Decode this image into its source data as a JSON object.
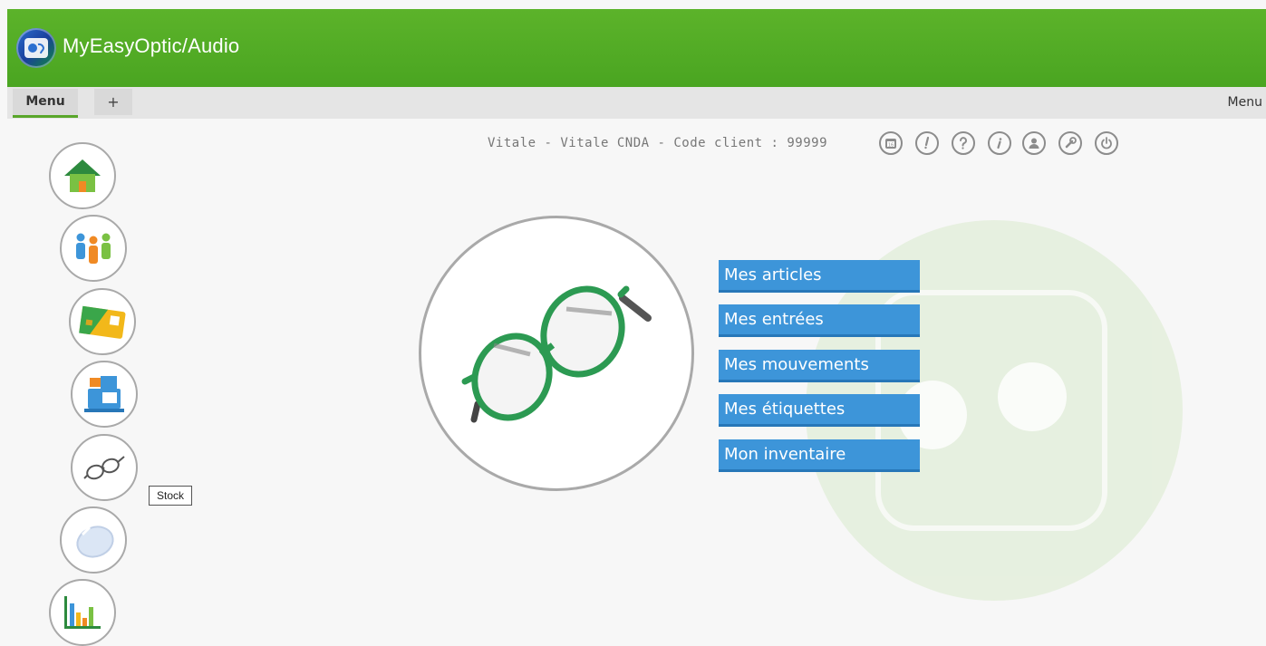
{
  "app": {
    "title": "MyEasyOptic/Audio"
  },
  "tabs": {
    "menu": "Menu",
    "add": "+",
    "right": "Menu"
  },
  "client_info": "Vitale - Vitale CNDA - Code client : 99999",
  "toolbar": [
    {
      "icon": "calendar-icon"
    },
    {
      "icon": "alert-icon"
    },
    {
      "icon": "help-icon"
    },
    {
      "icon": "info-icon"
    },
    {
      "icon": "user-icon"
    },
    {
      "icon": "settings-icon"
    },
    {
      "icon": "power-icon"
    }
  ],
  "sidebar": [
    {
      "icon": "home-icon"
    },
    {
      "icon": "clients-icon"
    },
    {
      "icon": "vitale-card-icon"
    },
    {
      "icon": "cash-register-icon"
    },
    {
      "icon": "glasses-icon",
      "tooltip": "Stock"
    },
    {
      "icon": "lens-icon"
    },
    {
      "icon": "stats-icon"
    }
  ],
  "stock_menu": {
    "items": [
      {
        "label": "Mes articles"
      },
      {
        "label": "Mes entrées"
      },
      {
        "label": "Mes mouvements"
      },
      {
        "label": "Mes étiquettes"
      },
      {
        "label": "Mon inventaire"
      }
    ]
  },
  "colors": {
    "header": "#4aa521",
    "button": "#3d95d9",
    "accent_tab": "#59a62a"
  }
}
